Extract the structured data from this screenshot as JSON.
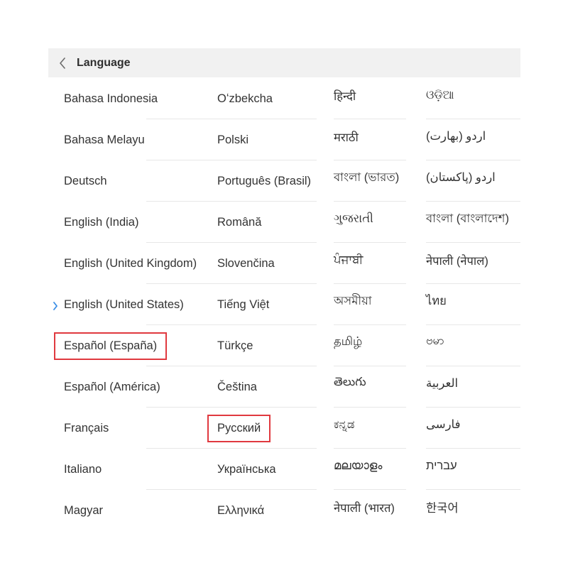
{
  "header": {
    "title": "Language",
    "back_icon": "chevron-left-icon"
  },
  "columns": [
    {
      "items": [
        {
          "label": "Bahasa Indonesia"
        },
        {
          "label": "Bahasa Melayu"
        },
        {
          "label": "Deutsch"
        },
        {
          "label": "English (India)"
        },
        {
          "label": "English (United Kingdom)"
        },
        {
          "label": "English (United States)",
          "selected": true
        },
        {
          "label": "Español (España)",
          "highlighted": true
        },
        {
          "label": "Español (América)"
        },
        {
          "label": "Français"
        },
        {
          "label": "Italiano"
        },
        {
          "label": "Magyar"
        }
      ]
    },
    {
      "items": [
        {
          "label": "Oʻzbekcha"
        },
        {
          "label": "Polski"
        },
        {
          "label": "Português (Brasil)"
        },
        {
          "label": "Română"
        },
        {
          "label": "Slovenčina"
        },
        {
          "label": "Tiếng Việt"
        },
        {
          "label": "Türkçe"
        },
        {
          "label": "Čeština"
        },
        {
          "label": "Русский",
          "highlighted": true
        },
        {
          "label": "Українська"
        },
        {
          "label": "Ελληνικά"
        }
      ]
    },
    {
      "items": [
        {
          "label": "हिन्दी"
        },
        {
          "label": "मराठी"
        },
        {
          "label": "বাংলা (ভারত)"
        },
        {
          "label": "ગુજરાતી"
        },
        {
          "label": "ਪੰਜਾਬੀ"
        },
        {
          "label": "অসমীয়া"
        },
        {
          "label": "தமிழ்"
        },
        {
          "label": "తెలుగు"
        },
        {
          "label": "ಕನ್ನಡ"
        },
        {
          "label": "മലയാളം"
        },
        {
          "label": "नेपाली (भारत)"
        }
      ]
    },
    {
      "items": [
        {
          "label": "ଓଡ଼ିଆ"
        },
        {
          "label": "اردو (بھارت)"
        },
        {
          "label": "اردو (پاکستان)"
        },
        {
          "label": "বাংলা (বাংলাদেশ)"
        },
        {
          "label": "नेपाली (नेपाल)"
        },
        {
          "label": "ไทย"
        },
        {
          "label": "ဗမာ"
        },
        {
          "label": "العربية"
        },
        {
          "label": "فارسی"
        },
        {
          "label": "עברית"
        },
        {
          "label": "한국어"
        }
      ]
    }
  ],
  "colors": {
    "header_bg": "#f1f1f1",
    "text": "#333333",
    "divider": "#e7e7e7",
    "highlight": "#e0393f",
    "selected_indicator": "#3a8ee6"
  },
  "icons": {
    "selected": "chevron-right-icon"
  }
}
